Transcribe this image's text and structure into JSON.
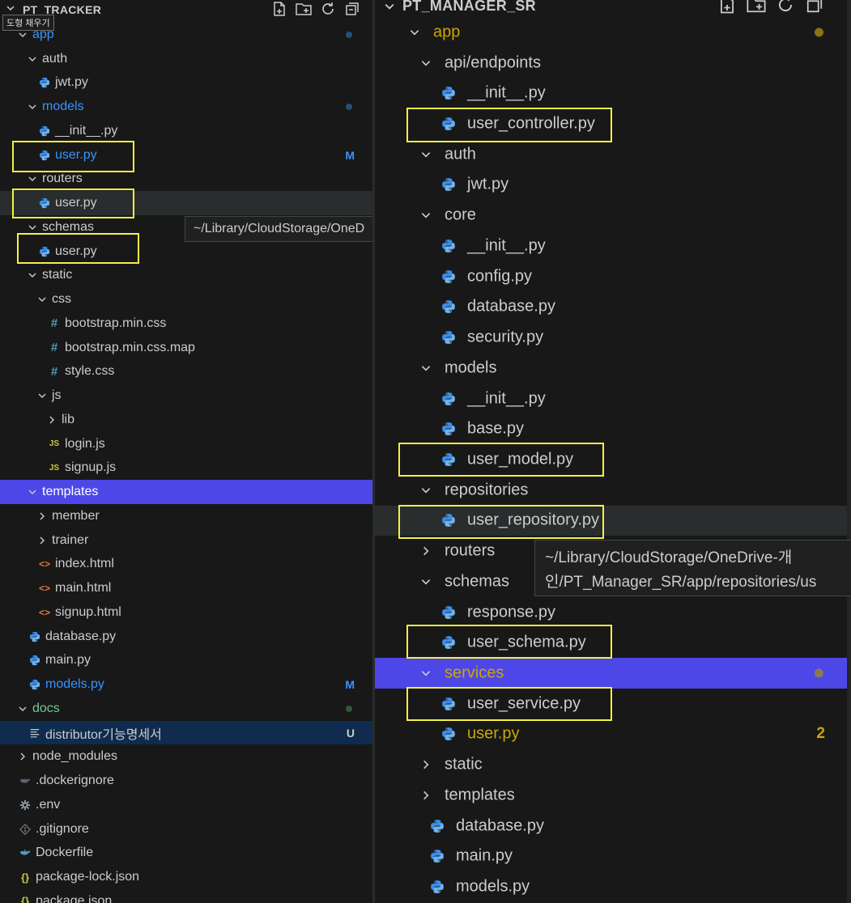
{
  "left": {
    "title": "PT_TRACKER",
    "overlay_label": "도형 채우기",
    "hover_tooltip": "~/Library/CloudStorage/OneD",
    "rows": [
      {
        "depth": 1,
        "type": "folder",
        "open": true,
        "label": "app",
        "color": "blue",
        "dot": "#264f78"
      },
      {
        "depth": 2,
        "type": "folder",
        "open": true,
        "label": "auth"
      },
      {
        "depth": 3,
        "type": "py",
        "label": "jwt.py"
      },
      {
        "depth": 2,
        "type": "folder",
        "open": true,
        "label": "models",
        "color": "blue",
        "dot": "#264f78"
      },
      {
        "depth": 3,
        "type": "py",
        "label": "__init__.py"
      },
      {
        "depth": 3,
        "type": "py",
        "label": "user.py",
        "color": "blue",
        "badge": "M",
        "badge_color": "blue"
      },
      {
        "depth": 2,
        "type": "folder",
        "open": true,
        "label": "routers"
      },
      {
        "depth": 3,
        "type": "py",
        "label": "user.py",
        "state": "hover"
      },
      {
        "depth": 2,
        "type": "folder",
        "open": true,
        "label": "schemas"
      },
      {
        "depth": 3,
        "type": "py",
        "label": "user.py"
      },
      {
        "depth": 2,
        "type": "folder",
        "open": true,
        "label": "static"
      },
      {
        "depth": 3,
        "type": "folder",
        "open": true,
        "label": "css"
      },
      {
        "depth": 4,
        "type": "css",
        "label": "bootstrap.min.css"
      },
      {
        "depth": 4,
        "type": "css",
        "label": "bootstrap.min.css.map"
      },
      {
        "depth": 4,
        "type": "css",
        "label": "style.css"
      },
      {
        "depth": 3,
        "type": "folder",
        "open": true,
        "label": "js"
      },
      {
        "depth": 4,
        "type": "folder",
        "open": false,
        "label": "lib"
      },
      {
        "depth": 4,
        "type": "js",
        "label": "login.js"
      },
      {
        "depth": 4,
        "type": "js",
        "label": "signup.js"
      },
      {
        "depth": 2,
        "type": "folder",
        "open": true,
        "label": "templates",
        "state": "selected"
      },
      {
        "depth": 3,
        "type": "folder",
        "open": false,
        "label": "member"
      },
      {
        "depth": 3,
        "type": "folder",
        "open": false,
        "label": "trainer"
      },
      {
        "depth": 3,
        "type": "html",
        "label": "index.html"
      },
      {
        "depth": 3,
        "type": "html",
        "label": "main.html"
      },
      {
        "depth": 3,
        "type": "html",
        "label": "signup.html"
      },
      {
        "depth": 2,
        "type": "py",
        "label": "database.py"
      },
      {
        "depth": 2,
        "type": "py",
        "label": "main.py"
      },
      {
        "depth": 2,
        "type": "py",
        "label": " models.py",
        "color": "blue",
        "badge": "M",
        "badge_color": "blue"
      },
      {
        "depth": 1,
        "type": "folder",
        "open": true,
        "label": "docs",
        "color": "green",
        "dot": "#2f5a3a"
      },
      {
        "depth": 2,
        "type": "doc",
        "label": "distributor기능명세서",
        "state": "focused",
        "badge": "U",
        "badge_color": "default"
      },
      {
        "depth": 1,
        "type": "folder",
        "open": false,
        "label": "node_modules"
      },
      {
        "depth": 1,
        "type": "docker-ignore",
        "label": ".dockerignore"
      },
      {
        "depth": 1,
        "type": "gear",
        "label": ".env"
      },
      {
        "depth": 1,
        "type": "git",
        "label": ".gitignore"
      },
      {
        "depth": 1,
        "type": "docker",
        "label": "Dockerfile"
      },
      {
        "depth": 1,
        "type": "json",
        "label": "package-lock.json"
      },
      {
        "depth": 1,
        "type": "json",
        "label": "package.json"
      }
    ]
  },
  "right": {
    "title": "PT_MANAGER_SR",
    "hover_tooltip_line1": "~/Library/CloudStorage/OneDrive-개",
    "hover_tooltip_line2": "인/PT_Manager_SR/app/repositories/us",
    "rows": [
      {
        "depth": 1,
        "type": "folder",
        "open": true,
        "label": "app",
        "color": "gold",
        "dot": "#8a7413"
      },
      {
        "depth": 2,
        "type": "folder",
        "open": true,
        "label": "api/endpoints"
      },
      {
        "depth": 3,
        "type": "py",
        "label": "__init__.py"
      },
      {
        "depth": 3,
        "type": "py",
        "label": "user_controller.py"
      },
      {
        "depth": 2,
        "type": "folder",
        "open": true,
        "label": "auth"
      },
      {
        "depth": 3,
        "type": "py",
        "label": "jwt.py"
      },
      {
        "depth": 2,
        "type": "folder",
        "open": true,
        "label": "core"
      },
      {
        "depth": 3,
        "type": "py",
        "label": "__init__.py"
      },
      {
        "depth": 3,
        "type": "py",
        "label": "config.py"
      },
      {
        "depth": 3,
        "type": "py",
        "label": "database.py"
      },
      {
        "depth": 3,
        "type": "py",
        "label": "security.py"
      },
      {
        "depth": 2,
        "type": "folder",
        "open": true,
        "label": "models"
      },
      {
        "depth": 3,
        "type": "py",
        "label": "__init__.py"
      },
      {
        "depth": 3,
        "type": "py",
        "label": "base.py"
      },
      {
        "depth": 3,
        "type": "py",
        "label": "user_model.py"
      },
      {
        "depth": 2,
        "type": "folder",
        "open": true,
        "label": "repositories"
      },
      {
        "depth": 3,
        "type": "py",
        "label": "user_repository.py",
        "state": "hover"
      },
      {
        "depth": 2,
        "type": "folder",
        "open": false,
        "label": "routers"
      },
      {
        "depth": 2,
        "type": "folder",
        "open": true,
        "label": "schemas"
      },
      {
        "depth": 3,
        "type": "py",
        "label": "response.py"
      },
      {
        "depth": 3,
        "type": "py",
        "label": "user_schema.py"
      },
      {
        "depth": 2,
        "type": "folder",
        "open": true,
        "label": "services",
        "color": "gold",
        "state": "selected",
        "dot": "#8a7a55"
      },
      {
        "depth": 3,
        "type": "py",
        "label": "user_service.py"
      },
      {
        "depth": 3,
        "type": "py",
        "label": "user.py",
        "color": "gold",
        "badge": "2",
        "badge_color": "gold"
      },
      {
        "depth": 2,
        "type": "folder",
        "open": false,
        "label": "static"
      },
      {
        "depth": 2,
        "type": "folder",
        "open": false,
        "label": "templates"
      },
      {
        "depth": 2,
        "type": "py",
        "label": "database.py"
      },
      {
        "depth": 2,
        "type": "py",
        "label": "main.py"
      },
      {
        "depth": 2,
        "type": "py",
        "label": " models.py"
      }
    ]
  },
  "colors": {
    "selection": "#4d47e8",
    "highlight_box": "#f5f043",
    "modified_blue": "#3794ff",
    "untracked_green": "#73c991",
    "warning_gold": "#cca700"
  }
}
